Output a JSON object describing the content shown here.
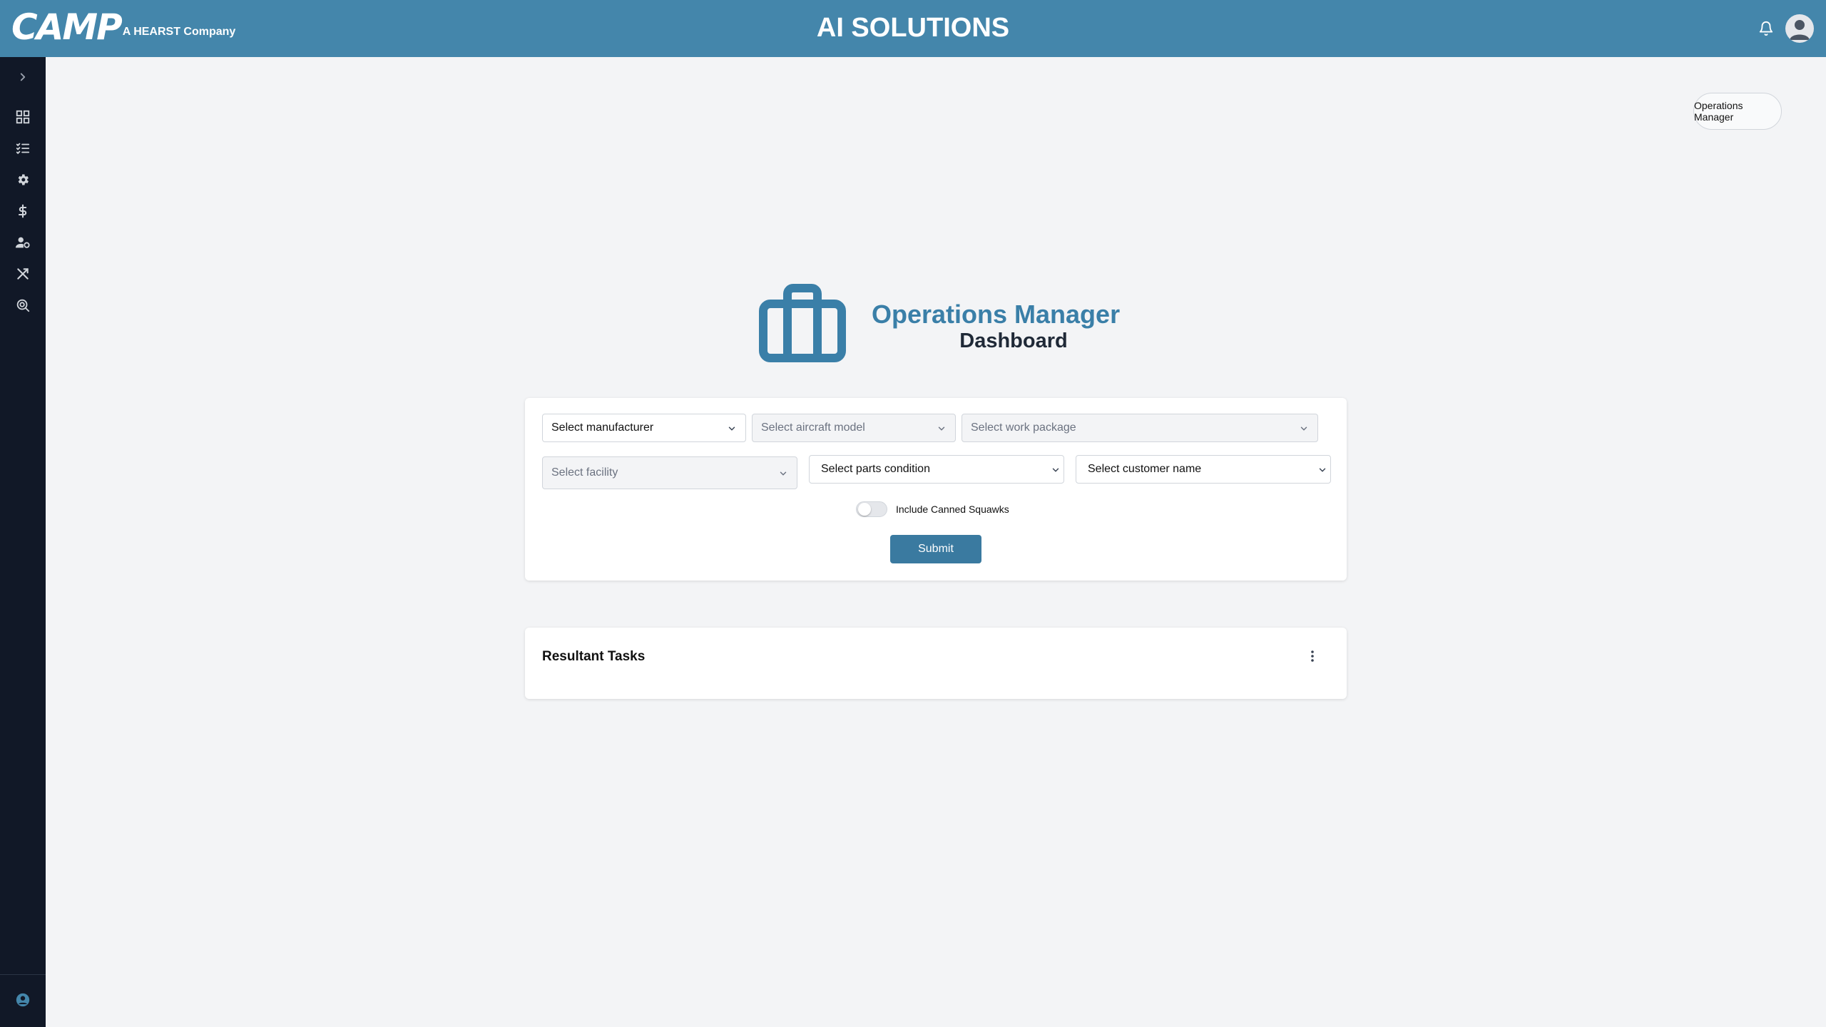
{
  "header": {
    "logo_text": "CAMP",
    "logo_sub": "A HEARST Company",
    "title": "AI SOLUTIONS",
    "icons": [
      "bell-icon",
      "user-avatar-icon"
    ]
  },
  "sidebar": {
    "items": [
      {
        "name": "expand",
        "icon": "chevron-right-icon"
      },
      {
        "name": "dashboard",
        "icon": "grid-icon"
      },
      {
        "name": "tasks",
        "icon": "checklist-icon"
      },
      {
        "name": "settings",
        "icon": "gear-icon"
      },
      {
        "name": "pricing",
        "icon": "dollar-icon"
      },
      {
        "name": "users",
        "icon": "user-settings-icon"
      },
      {
        "name": "tools",
        "icon": "tools-icon"
      },
      {
        "name": "search",
        "icon": "search-icon"
      }
    ],
    "footer_icon": "user-circle-icon"
  },
  "role_chip": "Operations Manager",
  "hero": {
    "title": "Operations Manager",
    "subtitle": "Dashboard",
    "icon": "briefcase-icon"
  },
  "filters": {
    "manufacturer": "Select manufacturer",
    "aircraft_model": "Select aircraft model",
    "work_package": "Select work package",
    "facility": "Select facility",
    "parts_condition": "Select parts condition",
    "customer_name": "Select customer name",
    "toggle_label": "Include Canned Squawks",
    "toggle_on": false,
    "submit_label": "Submit"
  },
  "results": {
    "title": "Resultant Tasks"
  },
  "colors": {
    "header": "#4486ab",
    "sidebar": "#111827",
    "accent": "#3a7aa0",
    "background": "#f3f4f6"
  }
}
